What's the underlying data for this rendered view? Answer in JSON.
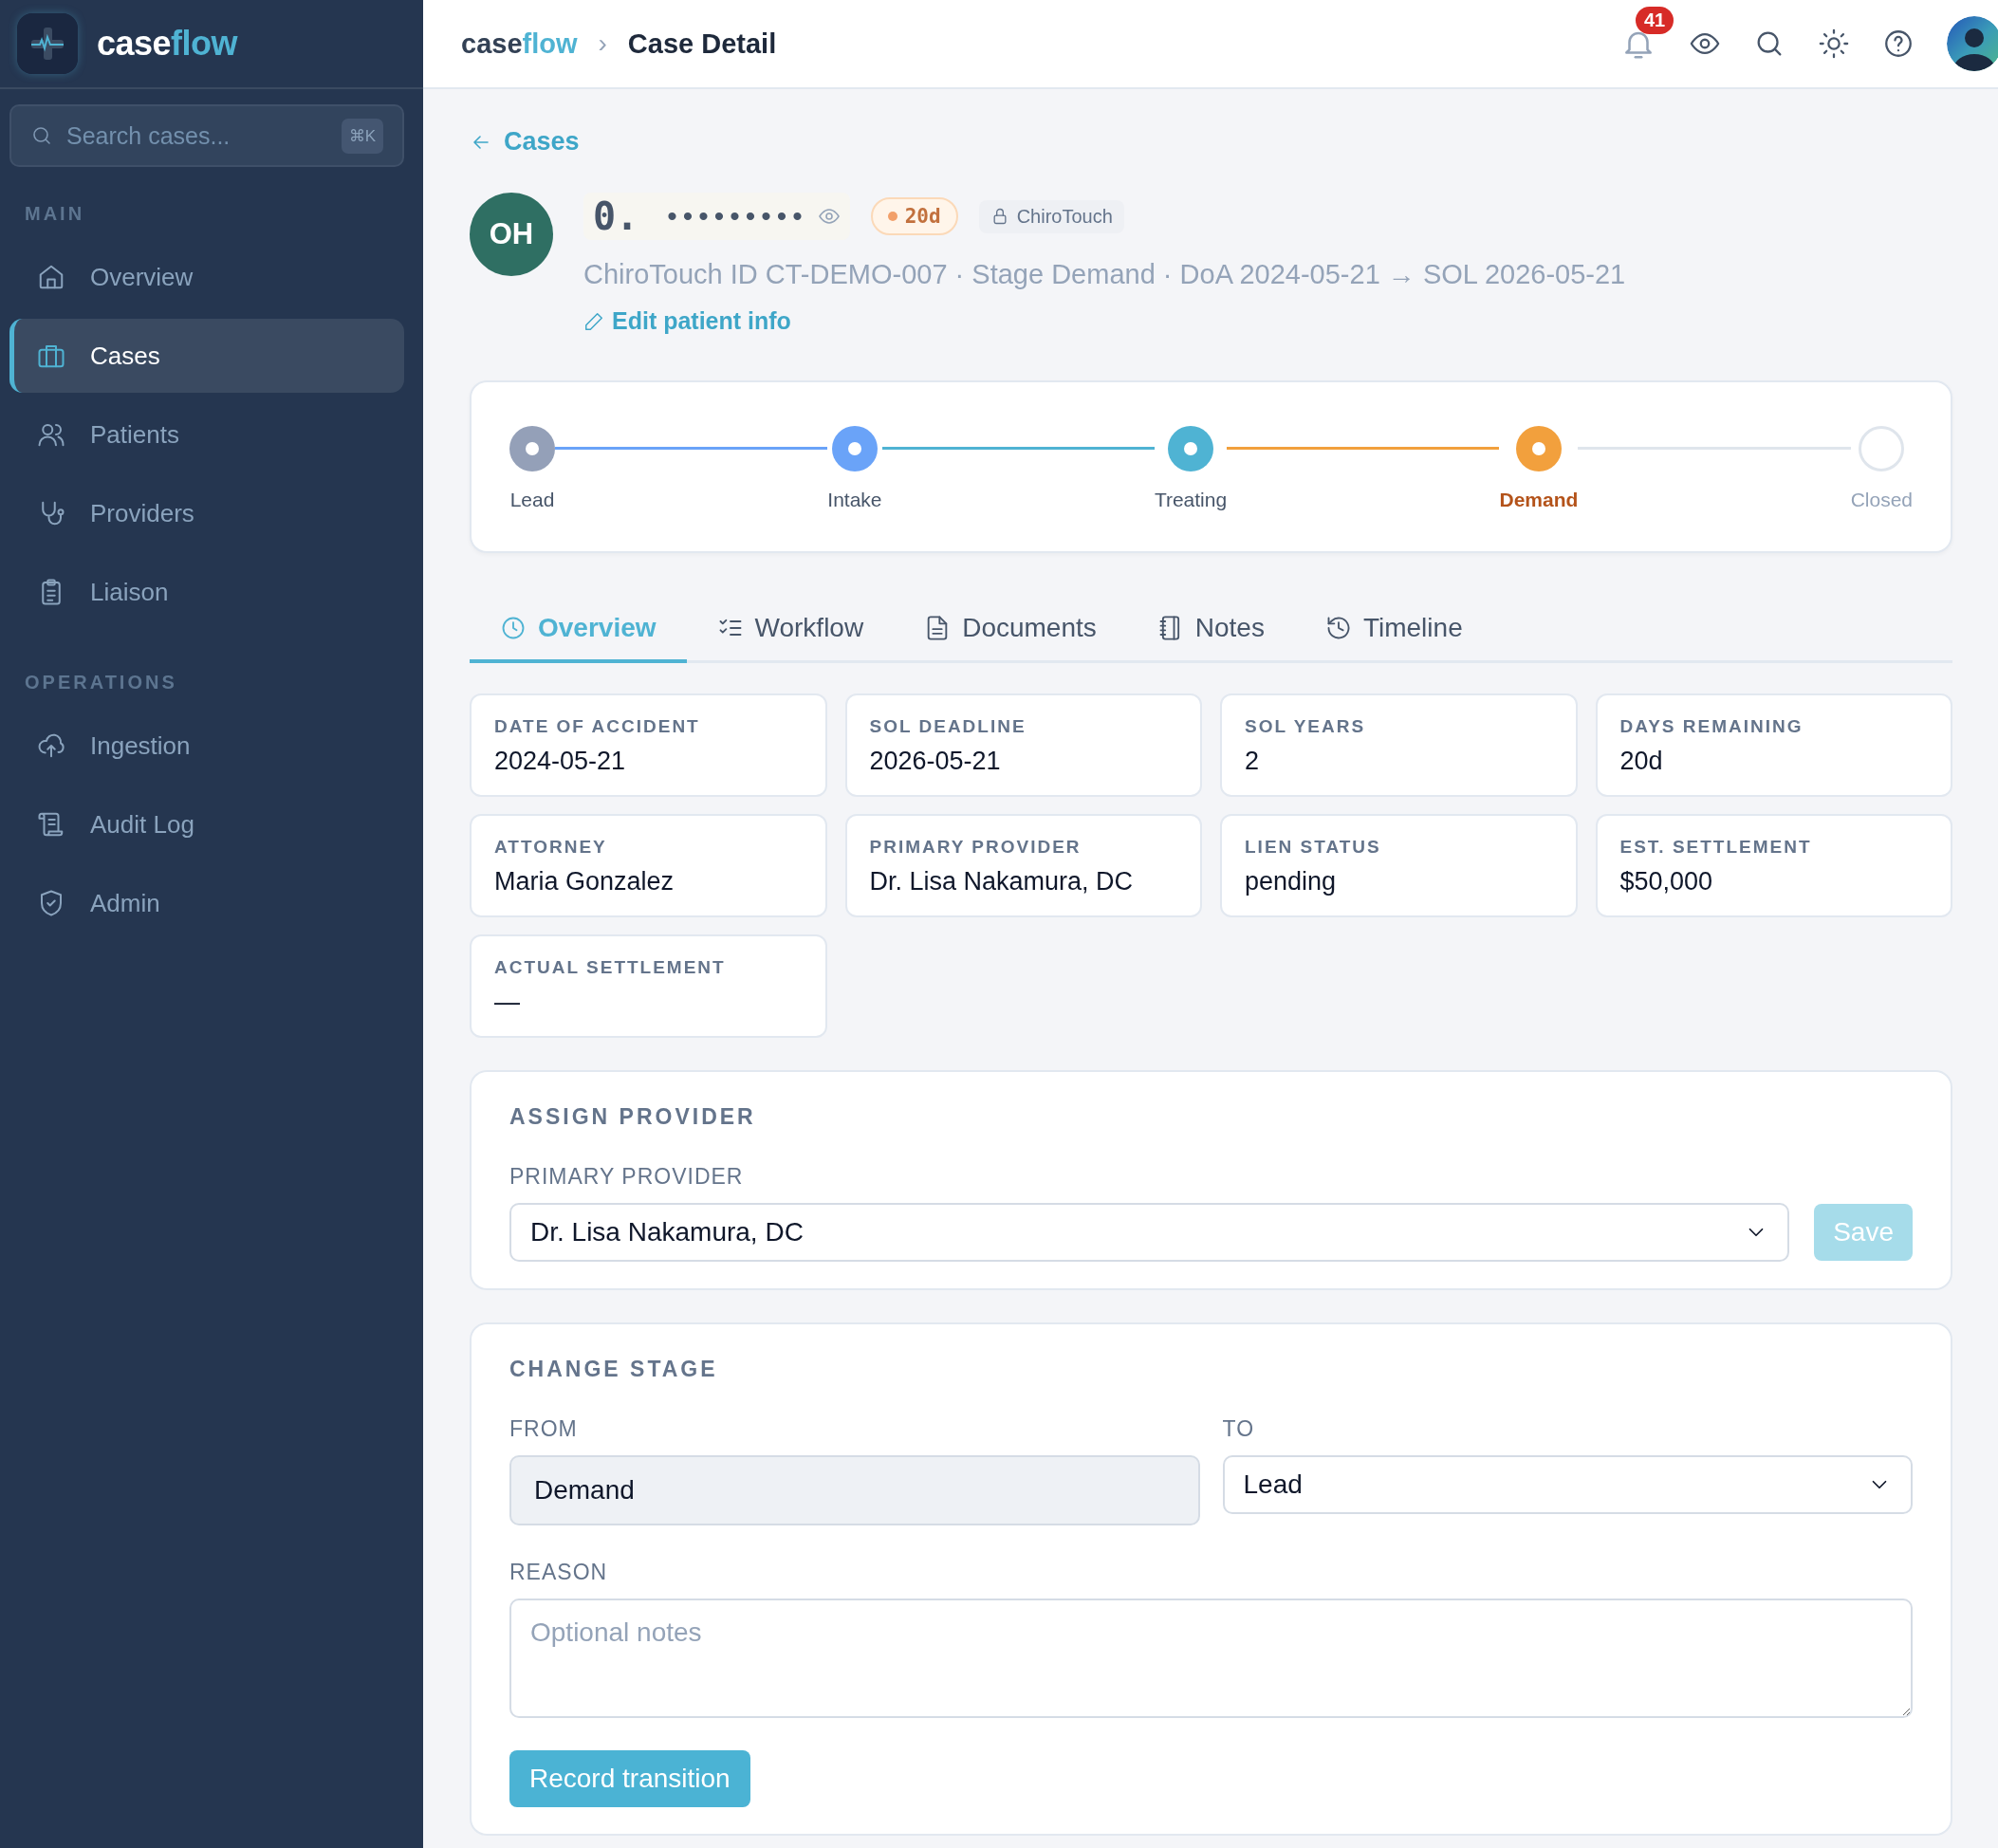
{
  "sidebar": {
    "brand": {
      "part_1": "case",
      "part_2": "flow"
    },
    "search": {
      "placeholder": "Search cases...",
      "shortcut": "⌘K"
    },
    "sections": [
      {
        "title": "MAIN",
        "items": [
          {
            "label": "Overview",
            "selected": false
          },
          {
            "label": "Cases",
            "selected": true
          },
          {
            "label": "Patients",
            "selected": false
          },
          {
            "label": "Providers",
            "selected": false
          },
          {
            "label": "Liaison",
            "selected": false
          }
        ]
      },
      {
        "title": "OPERATIONS",
        "items": [
          {
            "label": "Ingestion",
            "selected": false
          },
          {
            "label": "Audit Log",
            "selected": false
          },
          {
            "label": "Admin",
            "selected": false
          }
        ]
      }
    ]
  },
  "topbar": {
    "brand": {
      "part_1": "case",
      "part_2": "flow"
    },
    "breadcrumb_separator": "›",
    "page_title": "Case Detail",
    "notification_count": "41"
  },
  "back_link": "Cases",
  "patient": {
    "initials": "OH",
    "name": "0.",
    "masked": "•••••••••",
    "days_badge": "20d",
    "source_chip": "ChiroTouch",
    "subtitle": "ChiroTouch ID CT-DEMO-007 · Stage Demand · DoA 2024-05-21 → SOL 2026-05-21",
    "edit_link": "Edit patient info"
  },
  "stages": [
    {
      "label": "Lead",
      "completed": true,
      "current": false,
      "color": "#94a0b8"
    },
    {
      "label": "Intake",
      "completed": true,
      "current": false,
      "color": "#6aa3f8"
    },
    {
      "label": "Treating",
      "completed": true,
      "current": false,
      "color": "#4fb3d3"
    },
    {
      "label": "Demand",
      "completed": false,
      "current": true,
      "color": "#f2a03d"
    },
    {
      "label": "Closed",
      "completed": false,
      "current": false,
      "color": "#dfe5ec"
    }
  ],
  "tabs": [
    {
      "label": "Overview",
      "selected": true
    },
    {
      "label": "Workflow",
      "selected": false
    },
    {
      "label": "Documents",
      "selected": false
    },
    {
      "label": "Notes",
      "selected": false
    },
    {
      "label": "Timeline",
      "selected": false
    }
  ],
  "fields": [
    {
      "label": "DATE OF ACCIDENT",
      "value": "2024-05-21"
    },
    {
      "label": "SOL DEADLINE",
      "value": "2026-05-21"
    },
    {
      "label": "SOL YEARS",
      "value": "2"
    },
    {
      "label": "DAYS REMAINING",
      "value": "20d"
    },
    {
      "label": "ATTORNEY",
      "value": "Maria Gonzalez"
    },
    {
      "label": "PRIMARY PROVIDER",
      "value": "Dr. Lisa Nakamura, DC"
    },
    {
      "label": "LIEN STATUS",
      "value": "pending"
    },
    {
      "label": "EST. SETTLEMENT",
      "value": "$50,000"
    },
    {
      "label": "ACTUAL SETTLEMENT",
      "value": "—"
    }
  ],
  "assign_provider": {
    "title": "ASSIGN PROVIDER",
    "field_label": "PRIMARY PROVIDER",
    "value": "Dr. Lisa Nakamura, DC",
    "save_button": {
      "label": "Save",
      "disabled": true
    }
  },
  "change_stage": {
    "title": "CHANGE STAGE",
    "from_label": "FROM",
    "from_value": "Demand",
    "to_label": "TO",
    "to_value": "Lead",
    "reason_label": "REASON",
    "reason_placeholder": "Optional notes",
    "submit_button": "Record transition"
  }
}
